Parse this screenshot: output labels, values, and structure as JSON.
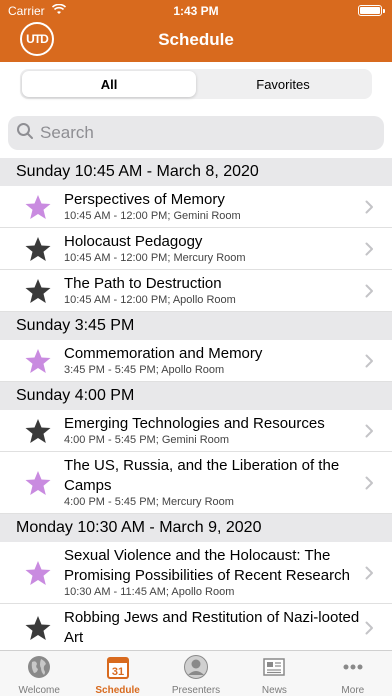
{
  "status_bar": {
    "carrier": "Carrier",
    "time": "1:43 PM"
  },
  "nav": {
    "title": "Schedule",
    "logo_text": "UTD"
  },
  "segment": {
    "all_label": "All",
    "favorites_label": "Favorites"
  },
  "search": {
    "placeholder": "Search"
  },
  "sections": [
    {
      "header": "Sunday 10:45 AM - March 8, 2020",
      "items": [
        {
          "title": "Perspectives of Memory",
          "subtitle": "10:45 AM - 12:00 PM; Gemini Room",
          "favorite": true
        },
        {
          "title": "Holocaust Pedagogy",
          "subtitle": "10:45 AM - 12:00 PM; Mercury Room",
          "favorite": false
        },
        {
          "title": "The Path to Destruction",
          "subtitle": "10:45 AM - 12:00 PM; Apollo Room",
          "favorite": false
        }
      ]
    },
    {
      "header": "Sunday 3:45 PM",
      "items": [
        {
          "title": "Commemoration and Memory",
          "subtitle": "3:45 PM - 5:45 PM; Apollo Room",
          "favorite": true
        }
      ]
    },
    {
      "header": "Sunday 4:00 PM",
      "items": [
        {
          "title": "Emerging Technologies and Resources",
          "subtitle": "4:00 PM - 5:45 PM; Gemini Room",
          "favorite": false
        },
        {
          "title": "The US, Russia, and the Liberation of the Camps",
          "subtitle": "4:00 PM - 5:45 PM; Mercury Room",
          "favorite": true
        }
      ]
    },
    {
      "header": "Monday 10:30 AM - March 9, 2020",
      "items": [
        {
          "title": "Sexual Violence and the Holocaust: The Promising Possibilities of Recent Research",
          "subtitle": "10:30 AM - 11:45 AM; Apollo Room",
          "favorite": true
        },
        {
          "title": "Robbing Jews and Restitution of Nazi-looted Art",
          "subtitle": "",
          "favorite": false
        }
      ]
    }
  ],
  "tabs": [
    {
      "label": "Welcome",
      "icon": "globe-icon",
      "active": false
    },
    {
      "label": "Schedule",
      "icon": "calendar-icon",
      "active": true,
      "icon_text": "31"
    },
    {
      "label": "Presenters",
      "icon": "person-icon",
      "active": false
    },
    {
      "label": "News",
      "icon": "newspaper-icon",
      "active": false
    },
    {
      "label": "More",
      "icon": "more-icon",
      "active": false
    }
  ],
  "colors": {
    "brand": "#d86a1e",
    "favorite_star": "#c98be0",
    "default_star": "#3a3a3a",
    "section_bg": "#e8e8ea"
  }
}
